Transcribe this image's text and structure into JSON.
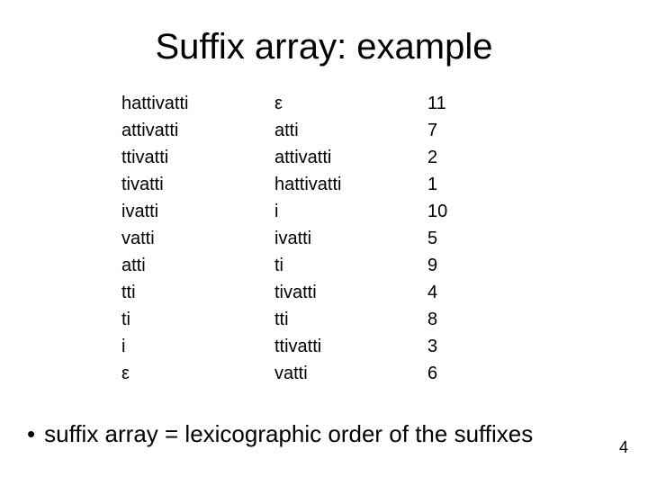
{
  "title": "Suffix array: example",
  "columns": {
    "suffixes": [
      "hattivatti",
      "attivatti",
      "ttivatti",
      "tivatti",
      "ivatti",
      "vatti",
      "atti",
      "tti",
      "ti",
      "i",
      "ε"
    ],
    "sorted": [
      "ε",
      "atti",
      "attivatti",
      "hattivatti",
      "i",
      "ivatti",
      "ti",
      "tivatti",
      "tti",
      "ttivatti",
      "vatti"
    ],
    "indices": [
      "11",
      "7",
      "2",
      "1",
      "10",
      "5",
      "9",
      "4",
      "8",
      "3",
      "6"
    ]
  },
  "bullet": "suffix array = lexicographic order of the suffixes",
  "page_number": "4"
}
